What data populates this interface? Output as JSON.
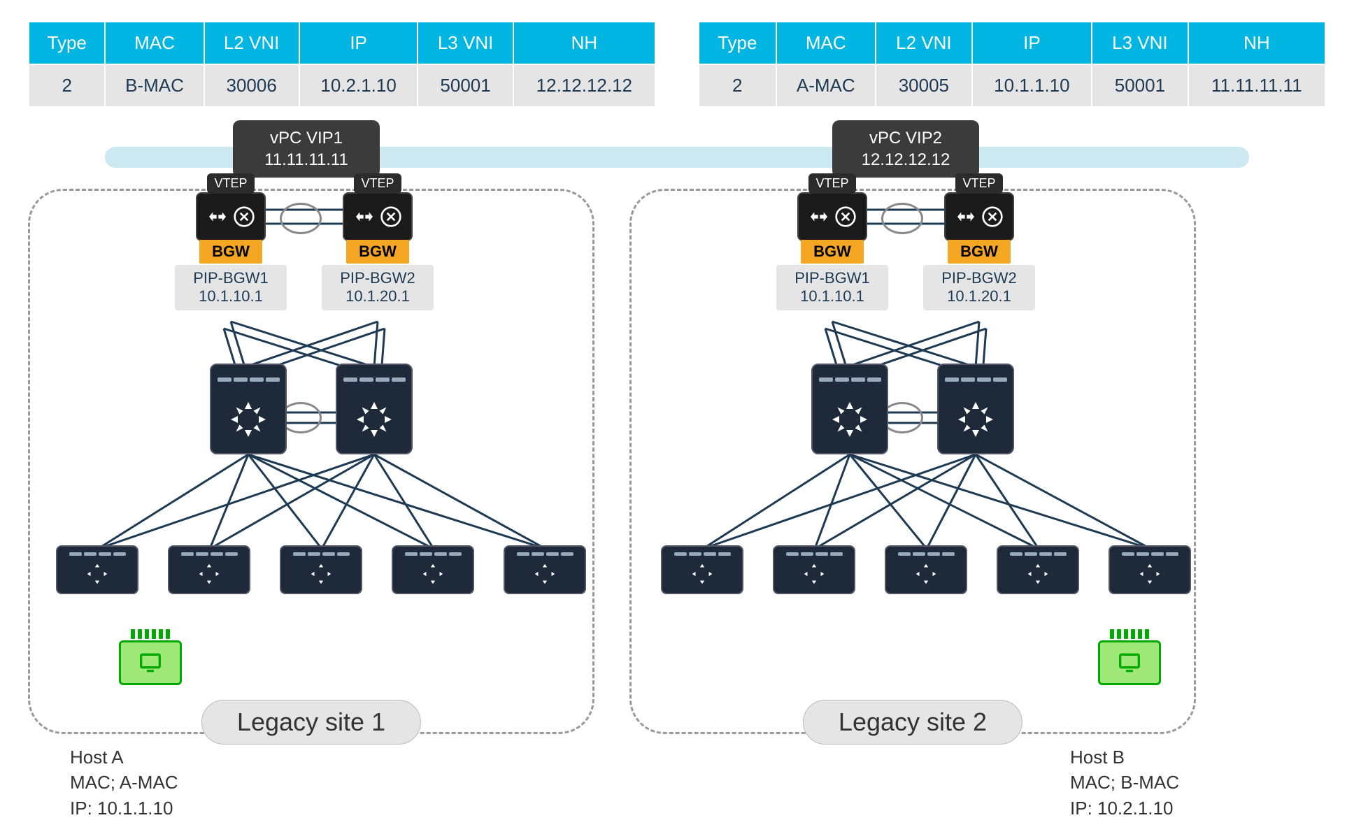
{
  "tables": {
    "headers": [
      "Type",
      "MAC",
      "L2 VNI",
      "IP",
      "L3 VNI",
      "NH"
    ],
    "left_row": {
      "type": "2",
      "mac": "B-MAC",
      "l2vni": "30006",
      "ip": "10.2.1.10",
      "l3vni": "50001",
      "nh": "12.12.12.12"
    },
    "right_row": {
      "type": "2",
      "mac": "A-MAC",
      "l2vni": "30005",
      "ip": "10.1.1.10",
      "l3vni": "50001",
      "nh": "11.11.11.11"
    }
  },
  "vip1": {
    "name": "vPC VIP1",
    "ip": "11.11.11.11"
  },
  "vip2": {
    "name": "vPC VIP2",
    "ip": "12.12.12.12"
  },
  "vtep_label": "VTEP",
  "bgw_label": "BGW",
  "site1": {
    "bgw1": {
      "name": "PIP-BGW1",
      "ip": "10.1.10.1"
    },
    "bgw2": {
      "name": "PIP-BGW2",
      "ip": "10.1.20.1"
    },
    "label": "Legacy site 1"
  },
  "site2": {
    "bgw1": {
      "name": "PIP-BGW1",
      "ip": "10.1.10.1"
    },
    "bgw2": {
      "name": "PIP-BGW2",
      "ip": "10.1.20.1"
    },
    "label": "Legacy site 2"
  },
  "hostA": {
    "title": "Host A",
    "mac": "MAC; A-MAC",
    "ip": "IP: 10.1.1.10"
  },
  "hostB": {
    "title": "Host B",
    "mac": "MAC; B-MAC",
    "ip": "IP: 10.2.1.10"
  }
}
